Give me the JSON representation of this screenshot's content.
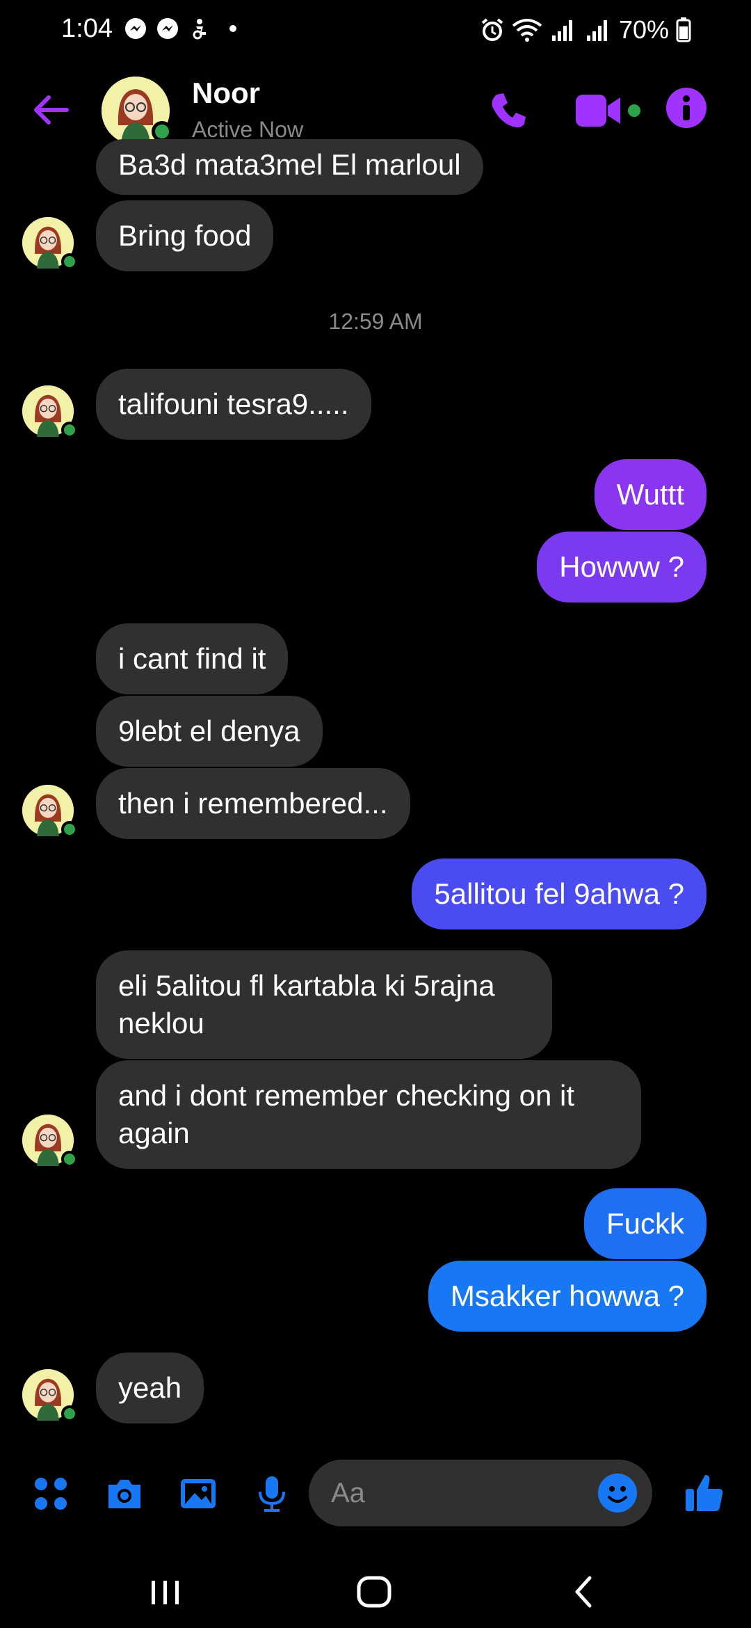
{
  "status_bar": {
    "time": "1:04",
    "battery": "70%"
  },
  "header": {
    "name": "Noor",
    "status": "Active Now"
  },
  "timestamp": "12:59 AM",
  "messages": [
    "Ba3d mata3mel El marloul",
    "Bring food",
    "talifouni tesra9.....",
    "Wuttt",
    "Howww ?",
    "i cant find it",
    "9lebt el denya",
    "then i remembered...",
    "5allitou fel 9ahwa ?",
    "eli 5alitou fl kartabla ki 5rajna neklou",
    "and i dont remember checking on it again",
    "Fuckk",
    "Msakker howwa ?",
    "yeah"
  ],
  "composer": {
    "placeholder": "Aa"
  },
  "colors": {
    "accent": "#a033ff",
    "blue": "#1877f2",
    "incoming": "#303030"
  }
}
